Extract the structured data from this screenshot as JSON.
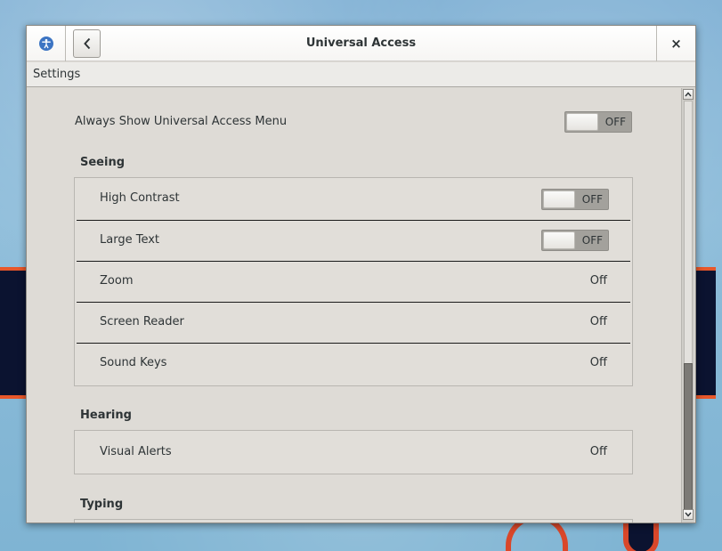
{
  "window": {
    "title": "Universal Access",
    "close_label": "×"
  },
  "menubar": {
    "settings_label": "Settings"
  },
  "always_show": {
    "label": "Always Show Universal Access Menu",
    "state": "OFF"
  },
  "seeing": {
    "title": "Seeing",
    "rows": [
      {
        "label": "High Contrast",
        "state": "OFF",
        "kind": "switch"
      },
      {
        "label": "Large Text",
        "state": "OFF",
        "kind": "switch"
      },
      {
        "label": "Zoom",
        "value": "Off",
        "kind": "value"
      },
      {
        "label": "Screen Reader",
        "value": "Off",
        "kind": "value"
      },
      {
        "label": "Sound Keys",
        "value": "Off",
        "kind": "value"
      }
    ]
  },
  "hearing": {
    "title": "Hearing",
    "rows": [
      {
        "label": "Visual Alerts",
        "value": "Off",
        "kind": "value"
      }
    ]
  },
  "typing": {
    "title": "Typing"
  },
  "icons": {
    "ua": "universal-access-icon",
    "back": "chevron-left-icon",
    "close": "close-icon",
    "scroll_up": "arrow-up-icon",
    "scroll_down": "arrow-down-icon"
  },
  "colors": {
    "window_bg": "#dedbd6",
    "accent_blue": "#3c74c3",
    "switch_off_bg": "#a3a19c"
  }
}
